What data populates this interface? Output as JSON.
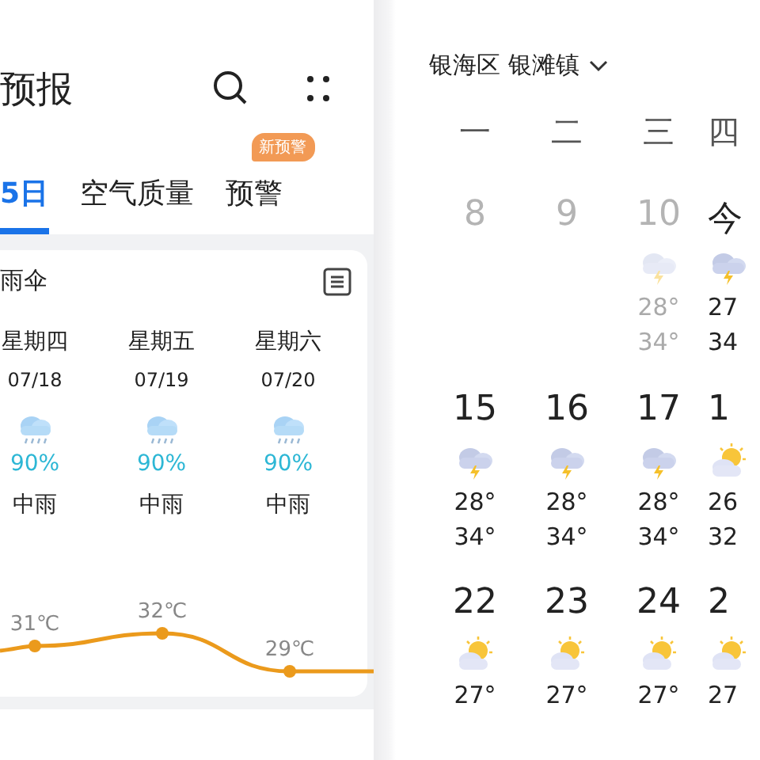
{
  "forecast": {
    "title": "预报",
    "tabs": [
      {
        "label": "5日",
        "selected": true
      },
      {
        "label": "空气质量",
        "selected": false
      },
      {
        "label": "预警",
        "selected": false,
        "badge": "新预警"
      }
    ],
    "card": {
      "title": "雨伞",
      "days": [
        {
          "weekday": "星期四",
          "date": "07/18",
          "kind": "rain",
          "precip": "90%",
          "condition": "中雨",
          "temperature": "31℃"
        },
        {
          "weekday": "星期五",
          "date": "07/19",
          "kind": "rain",
          "precip": "90%",
          "condition": "中雨",
          "temperature": "32℃"
        },
        {
          "weekday": "星期六",
          "date": "07/20",
          "kind": "rain",
          "precip": "90%",
          "condition": "中雨",
          "temperature": "29℃"
        }
      ]
    }
  },
  "calendar": {
    "location": "银海区 银滩镇",
    "weekdays": [
      "一",
      "二",
      "三",
      "四"
    ],
    "weeks": [
      [
        {
          "day": "8",
          "past": true
        },
        {
          "day": "9",
          "past": true
        },
        {
          "day": "10",
          "past": true,
          "kind": "thunder",
          "low": "28°",
          "high": "34°"
        },
        {
          "day": "今",
          "past": false,
          "kind": "thunder",
          "low": "27",
          "high": "34"
        }
      ],
      [
        {
          "day": "15",
          "past": false,
          "kind": "thunder",
          "low": "28°",
          "high": "34°"
        },
        {
          "day": "16",
          "past": false,
          "kind": "thunder",
          "low": "28°",
          "high": "34°"
        },
        {
          "day": "17",
          "past": false,
          "kind": "thunder",
          "low": "28°",
          "high": "34°"
        },
        {
          "day": "1",
          "past": false,
          "kind": "sun",
          "low": "26",
          "high": "32"
        }
      ],
      [
        {
          "day": "22",
          "past": false,
          "kind": "sun",
          "low": "27°"
        },
        {
          "day": "23",
          "past": false,
          "kind": "sun",
          "low": "27°"
        },
        {
          "day": "24",
          "past": false,
          "kind": "sun",
          "low": "27°"
        },
        {
          "day": "2",
          "past": false,
          "kind": "sun",
          "low": "27"
        }
      ]
    ]
  }
}
